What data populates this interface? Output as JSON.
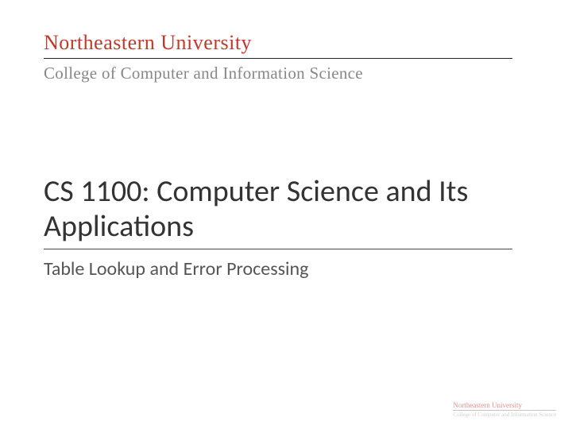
{
  "header": {
    "university": "Northeastern University",
    "college": "College of Computer and Information Science"
  },
  "main": {
    "course_title": "CS 1100: Computer Science and Its Applications",
    "subtitle": "Table Lookup and Error Processing"
  },
  "footer": {
    "university": "Northeastern University",
    "college": "College of Computer and Information Science"
  }
}
